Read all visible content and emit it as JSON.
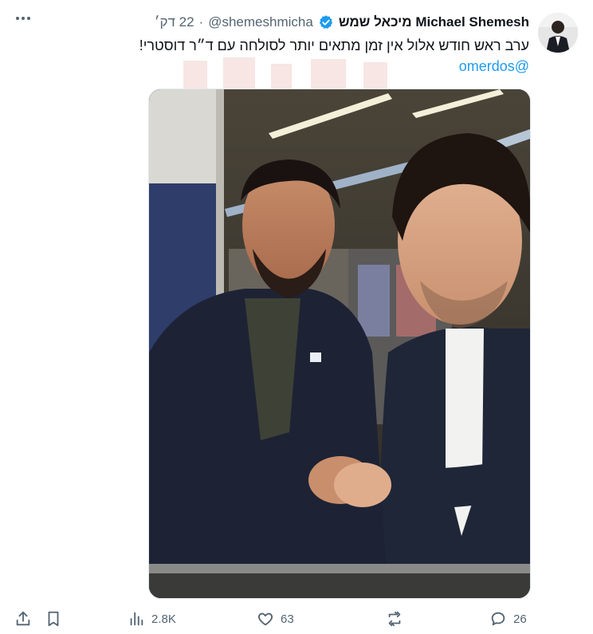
{
  "author": {
    "display_name": "Michael Shemesh מיכאל שמש",
    "handle": "@shemeshmicha",
    "time": "22 דק׳",
    "separator": "·"
  },
  "tweet": {
    "text": "ערב ראש חודש אלול אין זמן מתאים יותר לסולחה עם ד״ר דוסטרי!",
    "mention": "@omerdos"
  },
  "stats": {
    "views": "2.8K",
    "likes": "63",
    "retweets": "",
    "replies": "26"
  },
  "colors": {
    "accent": "#1d9bf0",
    "muted": "#536471",
    "text": "#0f1419"
  },
  "icons": [
    "more-icon",
    "verified-icon",
    "share-icon",
    "bookmark-icon",
    "views-icon",
    "like-icon",
    "retweet-icon",
    "reply-icon"
  ]
}
